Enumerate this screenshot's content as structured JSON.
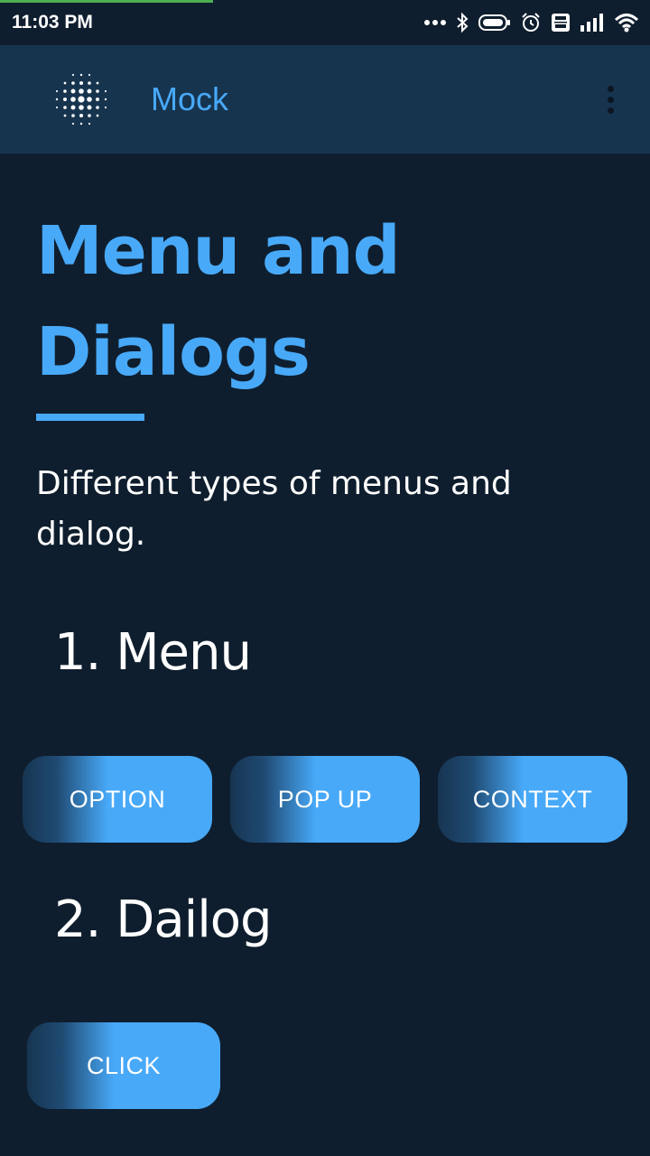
{
  "status_bar": {
    "time": "11:03 PM",
    "icons": [
      "more-dots-icon",
      "bluetooth-icon",
      "battery-icon",
      "alarm-icon",
      "volte-icon",
      "signal-icon",
      "wifi-icon"
    ]
  },
  "app_bar": {
    "title": "Mock",
    "logo_icon": "dot-grid-logo-icon",
    "menu_icon": "overflow-menu-icon"
  },
  "content": {
    "title_line1": "Menu and",
    "title_line2": "Dialogs",
    "subtitle": "Different types of menus and dialog.",
    "menu_section": {
      "heading": "1. Menu",
      "buttons": [
        "OPTION",
        "POP UP",
        "CONTEXT"
      ]
    },
    "dialog_section": {
      "heading": "2. Dailog",
      "button": "CLICK"
    }
  },
  "colors": {
    "background": "#0f1e2e",
    "app_bar": "#17344f",
    "accent": "#48a9f8",
    "text": "#ffffff"
  }
}
